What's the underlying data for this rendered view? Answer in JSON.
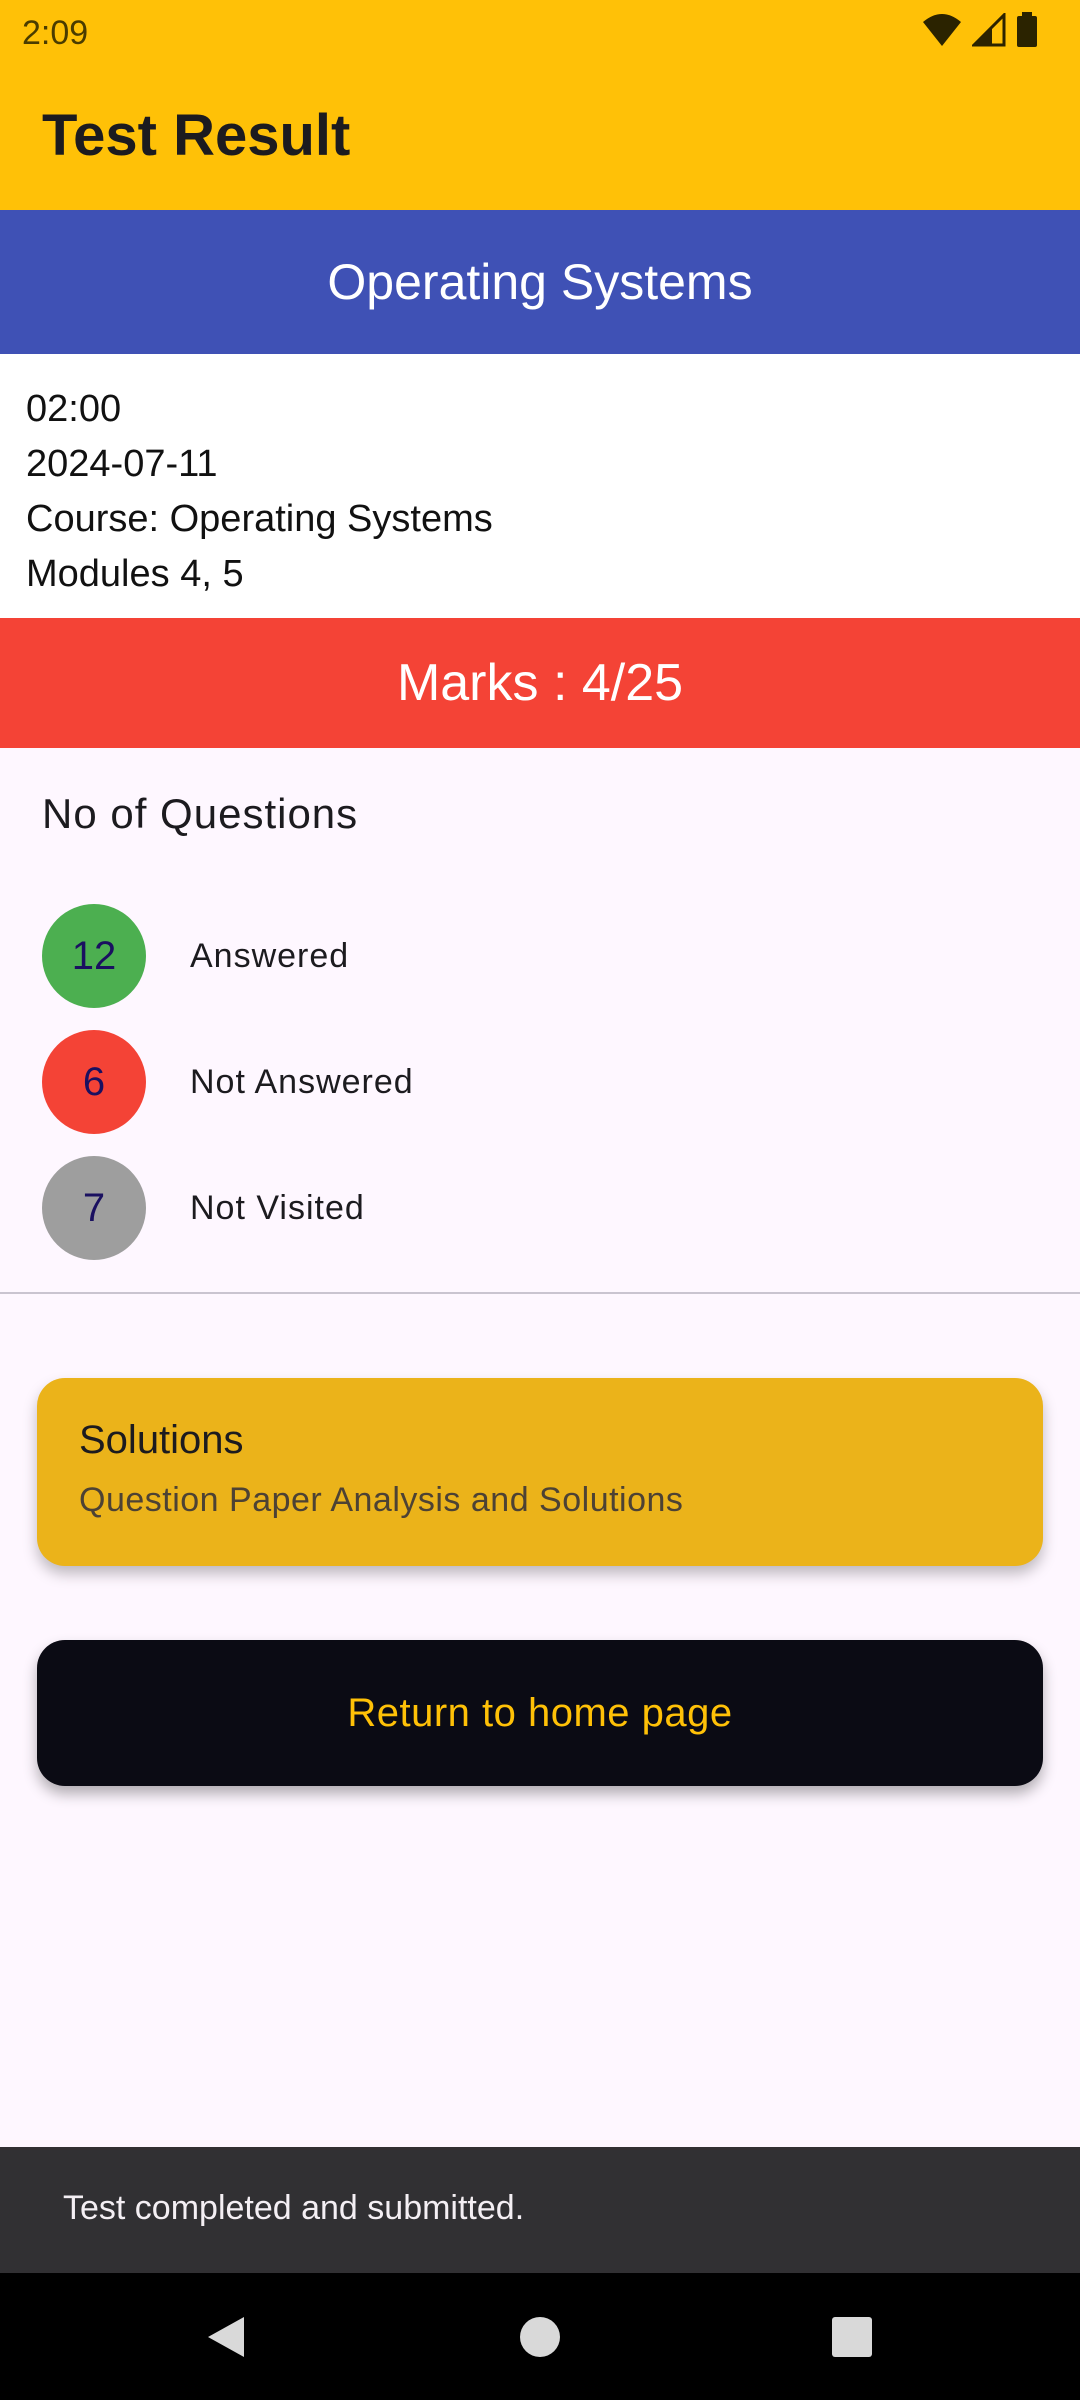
{
  "status_bar": {
    "time": "2:09",
    "icons": [
      "wifi-icon",
      "signal-icon",
      "battery-icon"
    ]
  },
  "app_bar": {
    "title": "Test Result"
  },
  "course_banner": {
    "title": "Operating Systems"
  },
  "test_info": {
    "time": "02:00",
    "date": "2024-07-11",
    "course": "Course: Operating Systems",
    "modules": "Modules 4, 5"
  },
  "marks": {
    "label": "Marks : 4/25"
  },
  "questions": {
    "title": "No of Questions",
    "items": [
      {
        "count": "12",
        "label": "Answered",
        "color": "#4caf50"
      },
      {
        "count": "6",
        "label": "Not Answered",
        "color": "#f44336"
      },
      {
        "count": "7",
        "label": "Not Visited",
        "color": "#9e9e9e"
      }
    ]
  },
  "solutions_card": {
    "title": "Solutions",
    "subtitle": "Question Paper Analysis and Solutions"
  },
  "home_button": {
    "label": "Return to home page"
  },
  "snackbar": {
    "message": "Test completed and submitted."
  },
  "navigation": {
    "icons": [
      "back-icon",
      "home-icon",
      "recents-icon"
    ]
  },
  "colors": {
    "accent": "#ffc107",
    "banner": "#3f51b5",
    "marks": "#f44336",
    "card": "#ebb31a"
  }
}
